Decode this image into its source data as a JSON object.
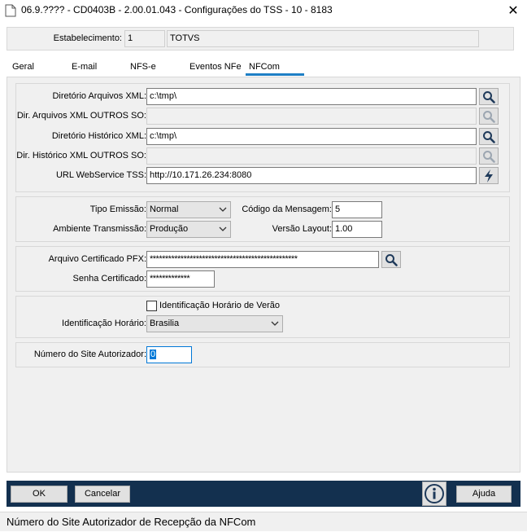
{
  "window": {
    "title": "06.9.???? - CD0403B - 2.00.01.043 - Configurações do TSS - 10 - 8183",
    "close_label": "✕"
  },
  "header": {
    "estabelecimento_label": "Estabelecimento:",
    "estabelecimento_code": "1",
    "estabelecimento_name": "TOTVS"
  },
  "tabs": [
    {
      "label": "Geral"
    },
    {
      "label": "E-mail"
    },
    {
      "label": "NFS-e"
    },
    {
      "label": "Eventos NFe"
    },
    {
      "label": "NFCom"
    }
  ],
  "directories": {
    "dir_xml_label": "Diretório Arquivos XML:",
    "dir_xml_value": "c:\\tmp\\",
    "dir_xml_outros_label": "Dir. Arquivos XML OUTROS SO:",
    "dir_xml_outros_value": "",
    "dir_hist_label": "Diretório Histórico XML:",
    "dir_hist_value": "c:\\tmp\\",
    "dir_hist_outros_label": "Dir. Histórico XML OUTROS SO:",
    "dir_hist_outros_value": "",
    "url_label": "URL WebService TSS:",
    "url_value": "http://10.171.26.234:8080"
  },
  "emission": {
    "tipo_label": "Tipo Emissão:",
    "tipo_value": "Normal",
    "ambiente_label": "Ambiente Transmissão:",
    "ambiente_value": "Produção",
    "codigo_label": "Código da Mensagem:",
    "codigo_value": "5",
    "versao_label": "Versão Layout:",
    "versao_value": "1.00"
  },
  "certificate": {
    "pfx_label": "Arquivo Certificado PFX:",
    "pfx_value": "************************************************",
    "senha_label": "Senha Certificado:",
    "senha_value": "*************"
  },
  "timezone": {
    "checkbox_label": "Identificação Horário de Verão",
    "horario_label": "Identificação Horário:",
    "horario_value": "Brasilia"
  },
  "site": {
    "label": "Número do Site Autorizador:",
    "value": "0"
  },
  "buttons": {
    "ok": "OK",
    "cancel": "Cancelar",
    "help": "Ajuda"
  },
  "status": {
    "text": "Número do Site Autorizador de Recepção da NFCom"
  },
  "colors": {
    "bottom_bar": "#13304f",
    "active_tab": "#1e7fc5",
    "focus_border": "#0078d7"
  }
}
